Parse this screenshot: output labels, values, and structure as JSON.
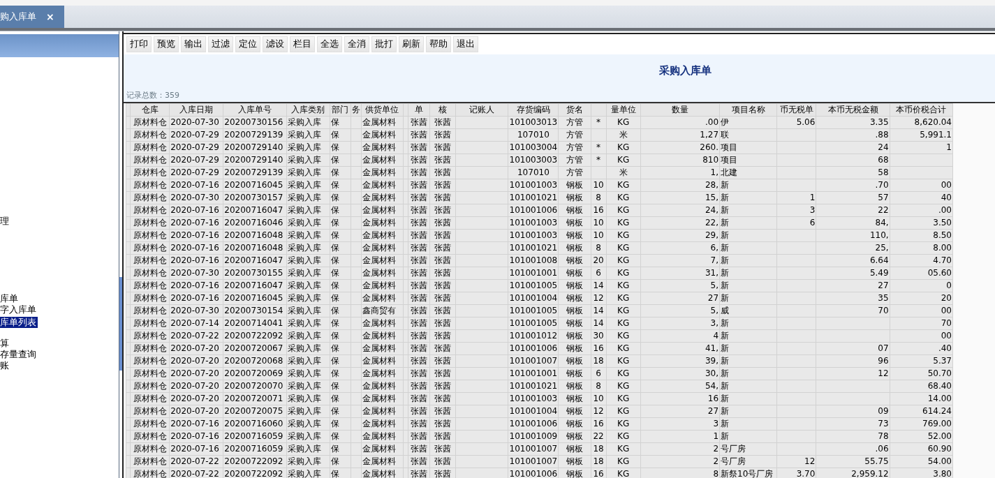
{
  "tabs": [
    {
      "label": "购入库单",
      "close": "×",
      "selected": true
    }
  ],
  "sidebar": {
    "items": [
      {
        "label": "理",
        "selected": false
      },
      {
        "label": "库单",
        "selected": false
      },
      {
        "label": "字入库单",
        "selected": false
      },
      {
        "label": "库单列表",
        "selected": true
      },
      {
        "label": "算",
        "selected": false
      },
      {
        "label": "存量查询",
        "selected": false
      },
      {
        "label": "账",
        "selected": false
      }
    ]
  },
  "toolbar": {
    "buttons": [
      "打印",
      "预览",
      "输出",
      "过滤",
      "定位",
      "滤设",
      "栏目",
      "全选",
      "全消",
      "批打",
      "刷新",
      "帮助",
      "退出"
    ]
  },
  "report": {
    "title": "采购入库单",
    "record_count": "记录总数：359"
  },
  "table": {
    "columns": [
      "仓库",
      "入库日期",
      "入库单号",
      "入库类别",
      "部门",
      "务",
      "供货单位",
      null,
      "单",
      "核",
      "记账人",
      "存货编码",
      "货名",
      null,
      "量单位",
      "数量",
      "项目名称",
      "币无税单",
      "本币无税金额",
      "本币价税合计"
    ],
    "rows": [
      [
        "原材料仓",
        "2020-07-30",
        "20200730156",
        "采购入库",
        "保",
        null,
        "金属材料",
        null,
        "张茜",
        "张茜",
        null,
        "101003013",
        "方管",
        "*",
        "KG",
        ".00",
        "伊",
        "5.06",
        "3.35",
        "8,620.04"
      ],
      [
        "原材料仓",
        "2020-07-29",
        "20200729139",
        "采购入库",
        "保",
        null,
        "金属材料",
        null,
        "张茜",
        "张茜",
        null,
        "107010",
        "方管",
        null,
        "米",
        "1,27",
        "联",
        null,
        ".88",
        "5,991.1"
      ],
      [
        "原材料仓",
        "2020-07-29",
        "20200729140",
        "采购入库",
        "保",
        null,
        "金属材料",
        null,
        "张茜",
        "张茜",
        null,
        "101003004",
        "方管",
        "*",
        "KG",
        "260.",
        "项目",
        null,
        "24",
        "1"
      ],
      [
        "原材料仓",
        "2020-07-29",
        "20200729140",
        "采购入库",
        "保",
        null,
        "金属材料",
        null,
        "张茜",
        "张茜",
        null,
        "101003003",
        "方管",
        "*",
        "KG",
        "810",
        "项目",
        null,
        "68",
        null
      ],
      [
        "原材料仓",
        "2020-07-29",
        "20200729139",
        "采购入库",
        "保",
        null,
        "金属材料",
        null,
        "张茜",
        "张茜",
        null,
        "107010",
        "方管",
        null,
        "米",
        "1,",
        "北建",
        null,
        "58",
        null
      ],
      [
        "原材料仓",
        "2020-07-16",
        "20200716045",
        "采购入库",
        "保",
        null,
        "金属材料",
        null,
        "张茜",
        "张茜",
        null,
        "101001003",
        "钢板",
        "10",
        "KG",
        "28,",
        "新",
        null,
        ".70",
        "00"
      ],
      [
        "原材料仓",
        "2020-07-30",
        "20200730157",
        "采购入库",
        "保",
        null,
        "金属材料",
        null,
        "张茜",
        "张茜",
        null,
        "101001021",
        "钢板",
        "8",
        "KG",
        "15,",
        "新",
        "1",
        "57",
        "40"
      ],
      [
        "原材料仓",
        "2020-07-16",
        "20200716047",
        "采购入库",
        "保",
        null,
        "金属材料",
        null,
        "张茜",
        "张茜",
        null,
        "101001006",
        "钢板",
        "16",
        "KG",
        "24,",
        "新",
        "3",
        "22",
        ".00"
      ],
      [
        "原材料仓",
        "2020-07-16",
        "20200716046",
        "采购入库",
        "保",
        null,
        "金属材料",
        null,
        "张茜",
        "张茜",
        null,
        "101001003",
        "钢板",
        "10",
        "KG",
        "22,",
        "新",
        "6",
        "84,",
        "3.50"
      ],
      [
        "原材料仓",
        "2020-07-16",
        "20200716048",
        "采购入库",
        "保",
        null,
        "金属材料",
        null,
        "张茜",
        "张茜",
        null,
        "101001003",
        "钢板",
        "10",
        "KG",
        "29,",
        "新",
        null,
        "110,",
        "8.50"
      ],
      [
        "原材料仓",
        "2020-07-16",
        "20200716048",
        "采购入库",
        "保",
        null,
        "金属材料",
        null,
        "张茜",
        "张茜",
        null,
        "101001021",
        "钢板",
        "8",
        "KG",
        "6,",
        "新",
        null,
        "25,",
        "8.00"
      ],
      [
        "原材料仓",
        "2020-07-16",
        "20200716047",
        "采购入库",
        "保",
        null,
        "金属材料",
        null,
        "张茜",
        "张茜",
        null,
        "101001008",
        "钢板",
        "20",
        "KG",
        "7,",
        "新",
        null,
        "6.64",
        "4.70"
      ],
      [
        "原材料仓",
        "2020-07-30",
        "20200730155",
        "采购入库",
        "保",
        null,
        "金属材料",
        null,
        "张茜",
        "张茜",
        null,
        "101001001",
        "钢板",
        "6",
        "KG",
        "31,",
        "新",
        null,
        "5.49",
        "05.60"
      ],
      [
        "原材料仓",
        "2020-07-16",
        "20200716047",
        "采购入库",
        "保",
        null,
        "金属材料",
        null,
        "张茜",
        "张茜",
        null,
        "101001005",
        "钢板",
        "14",
        "KG",
        "5,",
        "新",
        null,
        "27",
        "0"
      ],
      [
        "原材料仓",
        "2020-07-16",
        "20200716045",
        "采购入库",
        "保",
        null,
        "金属材料",
        null,
        "张茜",
        "张茜",
        null,
        "101001004",
        "钢板",
        "12",
        "KG",
        "27",
        "新",
        null,
        "35",
        "20"
      ],
      [
        "原材料仓",
        "2020-07-30",
        "20200730154",
        "采购入库",
        "保",
        null,
        "鑫商贸有",
        null,
        "张茜",
        "张茜",
        null,
        "101001005",
        "钢板",
        "14",
        "KG",
        "5,",
        "威",
        null,
        "70",
        "00"
      ],
      [
        "原材料仓",
        "2020-07-14",
        "20200714041",
        "采购入库",
        "保",
        null,
        "金属材料",
        null,
        "张茜",
        "张茜",
        null,
        "101001005",
        "钢板",
        "14",
        "KG",
        "3,",
        "新",
        null,
        null,
        "70"
      ],
      [
        "原材料仓",
        "2020-07-22",
        "20200722092",
        "采购入库",
        "保",
        null,
        "金属材料",
        null,
        "张茜",
        "张茜",
        null,
        "101001012",
        "钢板",
        "30",
        "KG",
        "4",
        "新",
        null,
        null,
        "00"
      ],
      [
        "原材料仓",
        "2020-07-20",
        "20200720067",
        "采购入库",
        "保",
        null,
        "金属材料",
        null,
        "张茜",
        "张茜",
        null,
        "101001006",
        "钢板",
        "16",
        "KG",
        "41,",
        "新",
        null,
        "07",
        ".40"
      ],
      [
        "原材料仓",
        "2020-07-20",
        "20200720068",
        "采购入库",
        "保",
        null,
        "金属材料",
        null,
        "张茜",
        "张茜",
        null,
        "101001007",
        "钢板",
        "18",
        "KG",
        "39,",
        "新",
        null,
        "96",
        "5.37"
      ],
      [
        "原材料仓",
        "2020-07-20",
        "20200720069",
        "采购入库",
        "保",
        null,
        "金属材料",
        null,
        "张茜",
        "张茜",
        null,
        "101001001",
        "钢板",
        "6",
        "KG",
        "30,",
        "新",
        null,
        "12",
        "50.70"
      ],
      [
        "原材料仓",
        "2020-07-20",
        "20200720070",
        "采购入库",
        "保",
        null,
        "金属材料",
        null,
        "张茜",
        "张茜",
        null,
        "101001021",
        "钢板",
        "8",
        "KG",
        "54,",
        "新",
        null,
        null,
        "68.40"
      ],
      [
        "原材料仓",
        "2020-07-20",
        "20200720071",
        "采购入库",
        "保",
        null,
        "金属材料",
        null,
        "张茜",
        "张茜",
        null,
        "101001003",
        "钢板",
        "10",
        "KG",
        "16",
        "新",
        null,
        null,
        "14.00"
      ],
      [
        "原材料仓",
        "2020-07-20",
        "20200720075",
        "采购入库",
        "保",
        null,
        "金属材料",
        null,
        "张茜",
        "张茜",
        null,
        "101001004",
        "钢板",
        "12",
        "KG",
        "27",
        "新",
        null,
        "09",
        "614.24"
      ],
      [
        "原材料仓",
        "2020-07-16",
        "20200716060",
        "采购入库",
        "保",
        null,
        "金属材料",
        null,
        "张茜",
        "张茜",
        null,
        "101001006",
        "钢板",
        "16",
        "KG",
        "3",
        "新",
        null,
        "73",
        "769.00"
      ],
      [
        "原材料仓",
        "2020-07-16",
        "20200716059",
        "采购入库",
        "保",
        null,
        "金属材料",
        null,
        "张茜",
        "张茜",
        null,
        "101001009",
        "钢板",
        "22",
        "KG",
        "1",
        "新",
        null,
        "78",
        "52.00"
      ],
      [
        "原材料仓",
        "2020-07-16",
        "20200716059",
        "采购入库",
        "保",
        null,
        "金属材料",
        null,
        "张茜",
        "张茜",
        null,
        "101001007",
        "钢板",
        "18",
        "KG",
        "2",
        "号厂房",
        null,
        ".06",
        "60.90"
      ],
      [
        "原材料仓",
        "2020-07-22",
        "20200722092",
        "采购入库",
        "保",
        null,
        "金属材料",
        null,
        "张茜",
        "张茜",
        null,
        "101001007",
        "钢板",
        "18",
        "KG",
        "2",
        "号厂房",
        "12",
        "55.75",
        "54.00"
      ],
      [
        "原材料仓",
        "2020-07-22",
        "20200722092",
        "采购入库",
        "保",
        null,
        "金属材料",
        null,
        "张茜",
        "张茜",
        null,
        "101001006",
        "钢板",
        "16",
        "KG",
        "8",
        "新祭10号厂房",
        "3.70",
        "2,959.12",
        "3.80"
      ]
    ]
  }
}
